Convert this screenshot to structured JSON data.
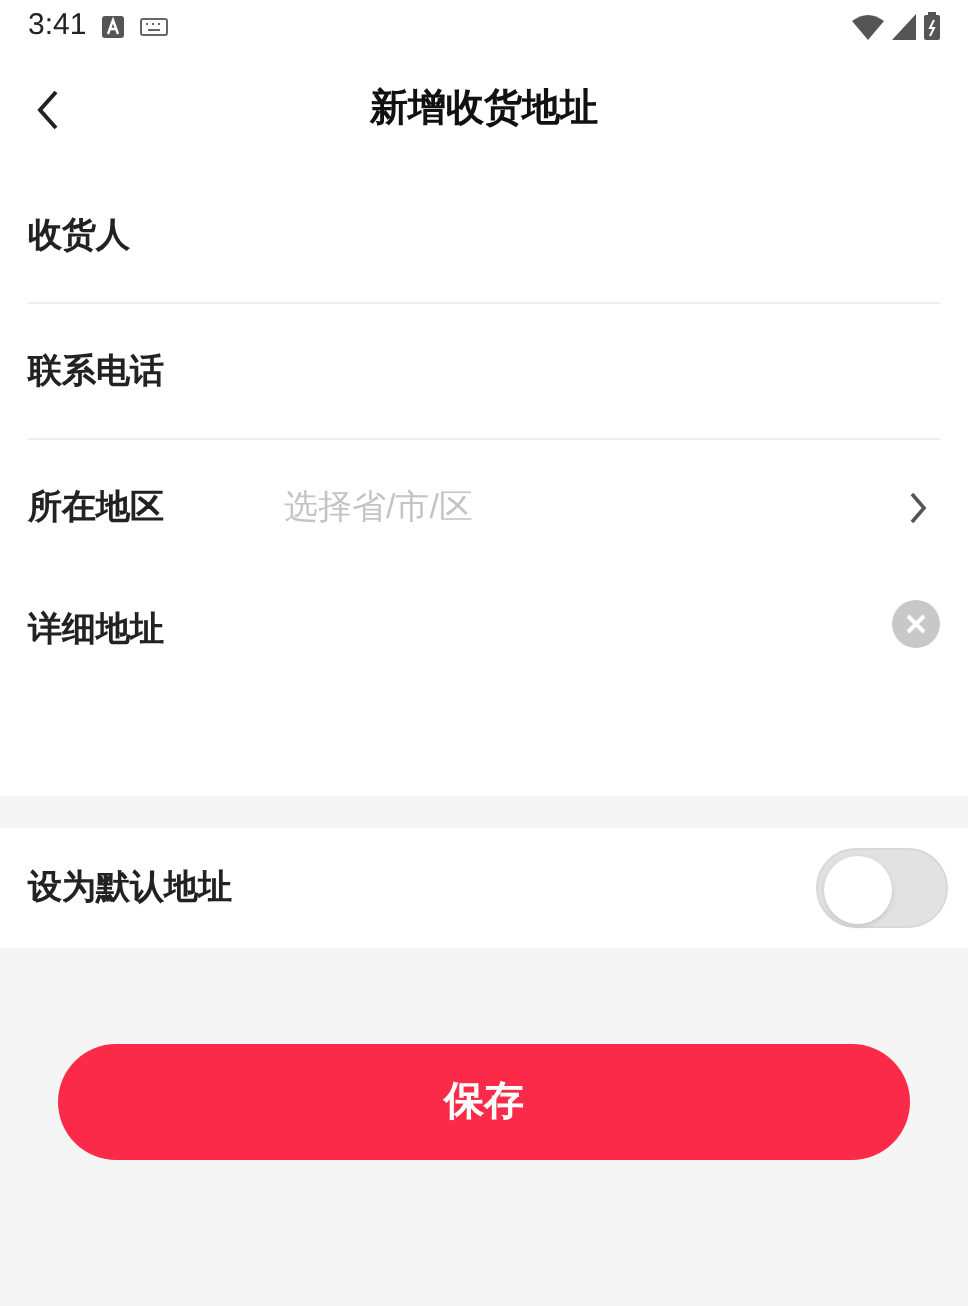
{
  "status_bar": {
    "time": "3:41"
  },
  "header": {
    "title": "新增收货地址"
  },
  "form_rows": [
    {
      "kind": "input",
      "label": "收货人"
    },
    {
      "kind": "input",
      "label": "联系电话"
    },
    {
      "kind": "select",
      "label": "所在地区",
      "placeholder": "选择省/市/区"
    },
    {
      "kind": "textarea",
      "label": "详细地址"
    }
  ],
  "default_address": {
    "label": "设为默认地址",
    "on": false
  },
  "save_button": "保存"
}
